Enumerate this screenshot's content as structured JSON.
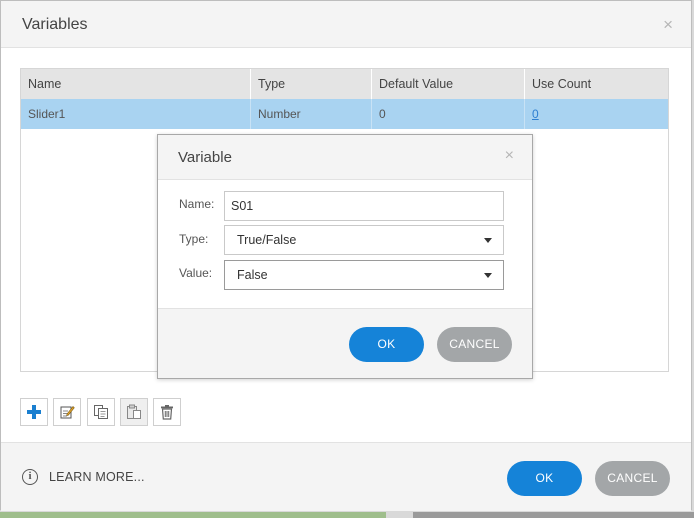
{
  "main_dialog": {
    "title": "Variables",
    "close_glyph": "×",
    "table": {
      "columns": [
        "Name",
        "Type",
        "Default Value",
        "Use Count"
      ],
      "rows": [
        {
          "name": "Slider1",
          "type": "Number",
          "default_value": "0",
          "use_count": "0"
        }
      ]
    },
    "toolbar_icons": [
      "add-icon",
      "edit-icon",
      "copy-icon",
      "paste-icon",
      "delete-icon"
    ],
    "footer": {
      "info_glyph": "i",
      "learn_more": "LEARN MORE...",
      "ok": "OK",
      "cancel": "CANCEL"
    }
  },
  "variable_dialog": {
    "title": "Variable",
    "close_glyph": "×",
    "fields": {
      "name_label": "Name:",
      "name_value": "S01",
      "type_label": "Type:",
      "type_value": "True/False",
      "value_label": "Value:",
      "value_value": "False"
    },
    "ok": "OK",
    "cancel": "CANCEL"
  },
  "colors": {
    "accent_blue": "#1583d8",
    "selected_row": "#a9d3f1",
    "cancel_gray": "#a3a6a8"
  }
}
